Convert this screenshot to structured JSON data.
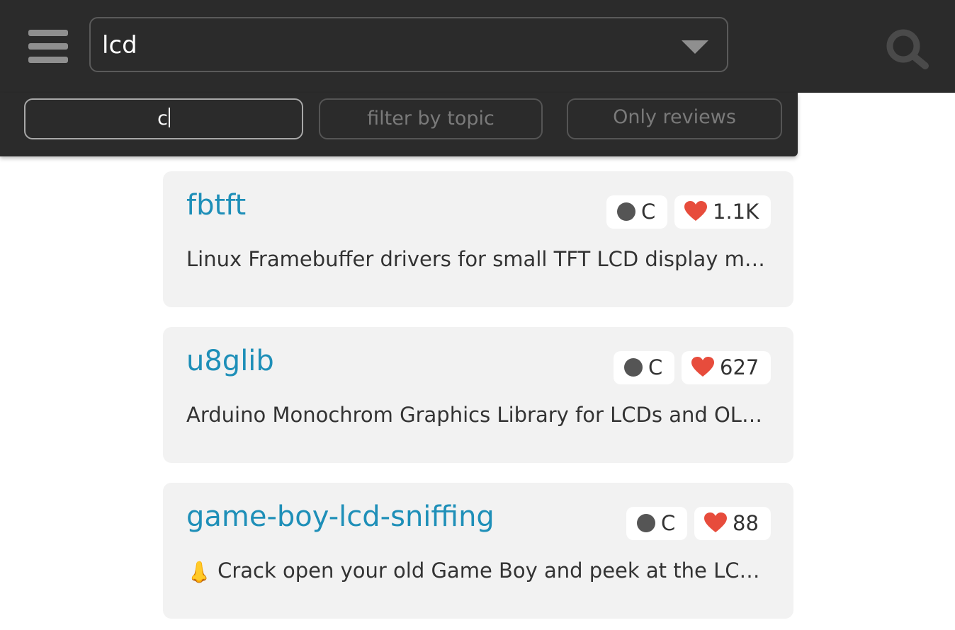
{
  "search": {
    "query": "lcd"
  },
  "filters": {
    "language_value": "c",
    "topic_placeholder": "filter by topic",
    "reviews_label": "Only reviews"
  },
  "icons": {
    "menu": "hamburger-menu-icon",
    "dropdown": "chevron-down-icon",
    "search": "search-icon",
    "language": "circle-dot-icon",
    "stars": "heart-icon",
    "description_emoji": "nose-emoji"
  },
  "colors": {
    "topbar_bg": "#2b2b2b",
    "title_link": "#1e8fb8",
    "heart": "#e74c3c",
    "card_bg": "#f2f2f2"
  },
  "results": [
    {
      "name": "fbtft",
      "language": "C",
      "stars": "1.1K",
      "description": "Linux Framebuffer drivers for small TFT LCD display modules"
    },
    {
      "name": "u8glib",
      "language": "C",
      "stars": "627",
      "description": "Arduino Monochrom Graphics Library for LCDs and OLEDs"
    },
    {
      "name": "game-boy-lcd-sniffing",
      "language": "C",
      "stars": "88",
      "emoji": "👃",
      "description": "Crack open your old Game Boy and peek at the LCD buffer"
    }
  ]
}
